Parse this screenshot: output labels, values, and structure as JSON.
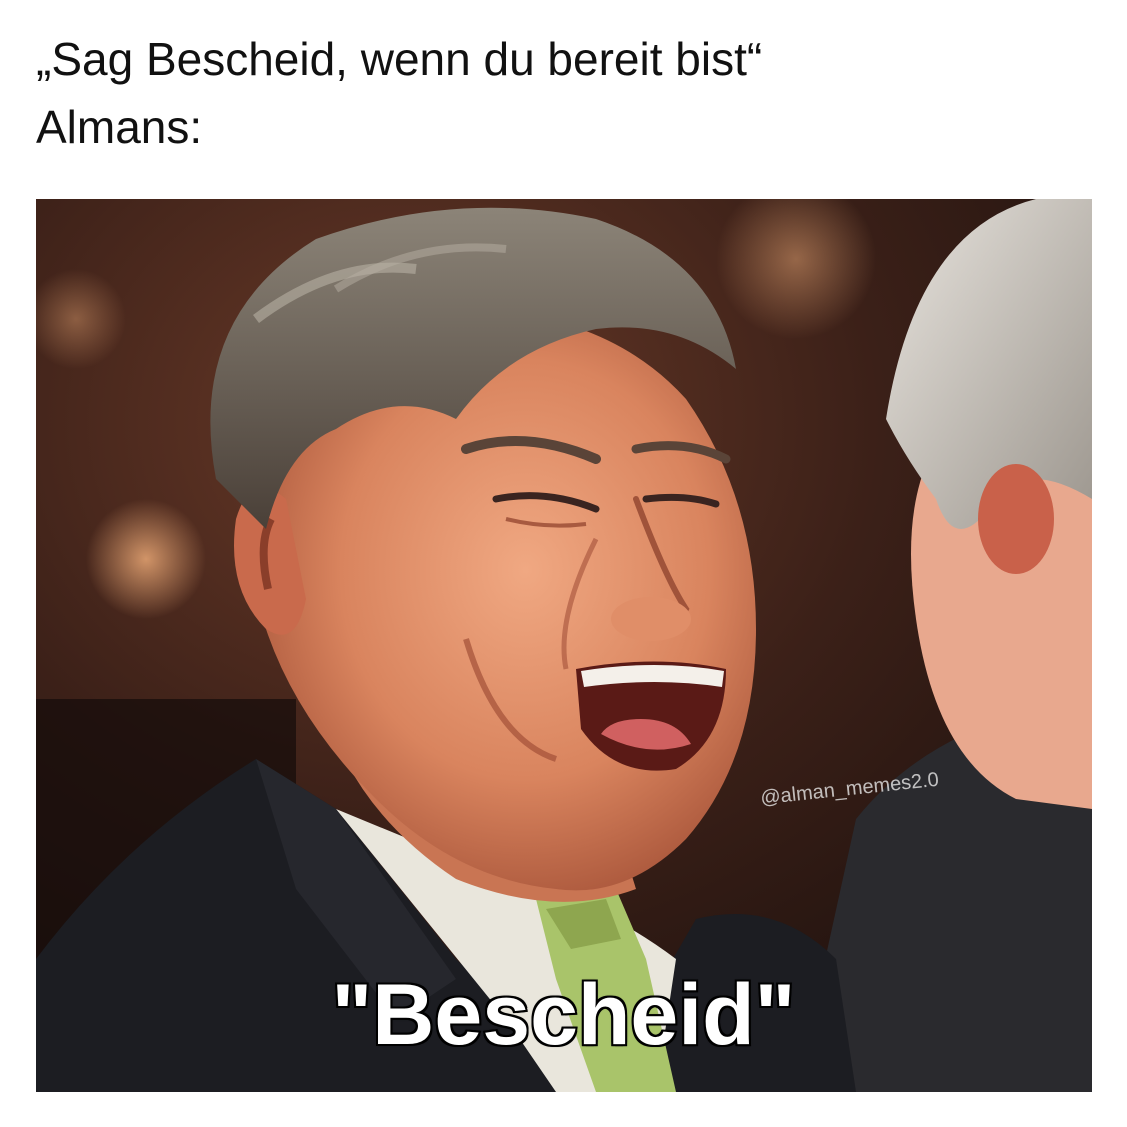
{
  "caption": {
    "line1": "„Sag Bescheid, wenn du bereit bist“",
    "line2": "Almans:"
  },
  "image": {
    "watermark": "@alman_memes2.0",
    "punchline": "\"Bescheid\""
  },
  "colors": {
    "background": "#ffffff",
    "caption_text": "#111111",
    "punchline_fill": "#ffffff",
    "punchline_stroke": "#000000",
    "suit": "#1c1d22",
    "tie": "#a9c46a",
    "skin": "#d98a63",
    "hair": "#6b6258"
  }
}
